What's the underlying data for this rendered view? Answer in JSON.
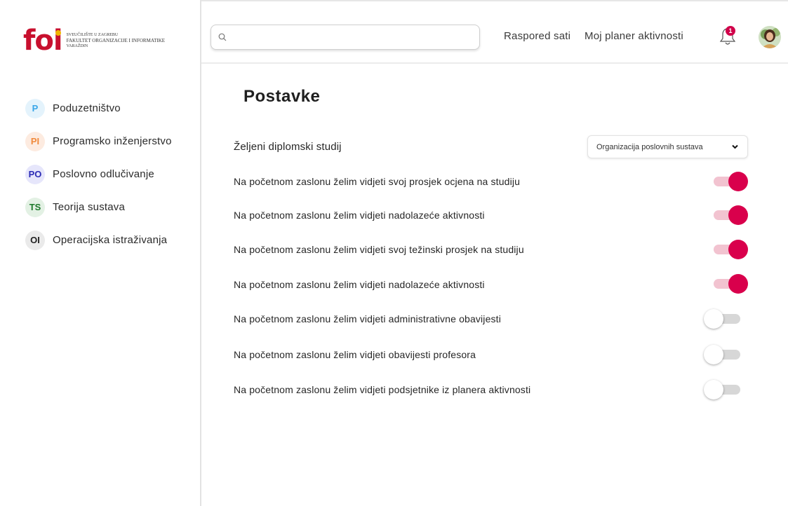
{
  "logo": {
    "mark": "foi",
    "line1": "Sveučilište u Zagrebu",
    "line2": "Fakultet organizacije i informatike",
    "line3": "Varaždin"
  },
  "sidebar": {
    "items": [
      {
        "abbr": "P",
        "label": "Poduzetništvo",
        "bg": "#e4f3fc",
        "fg": "#3aa6e8"
      },
      {
        "abbr": "PI",
        "label": "Programsko inženjerstvo",
        "bg": "#fdebe0",
        "fg": "#f08a3c"
      },
      {
        "abbr": "PO",
        "label": "Poslovno odlučivanje",
        "bg": "#e6e6fb",
        "fg": "#2b2bb5"
      },
      {
        "abbr": "TS",
        "label": "Teorija sustava",
        "bg": "#e3f1e4",
        "fg": "#1e7a2c"
      },
      {
        "abbr": "OI",
        "label": "Operacijska istraživanja",
        "bg": "#eaeaea",
        "fg": "#222222"
      }
    ]
  },
  "header": {
    "search_placeholder": "",
    "nav": [
      "Raspored sati",
      "Moj planer aktivnosti"
    ],
    "notification_count": "1"
  },
  "settings": {
    "title": "Postavke",
    "study_label": "Željeni diplomski studij",
    "study_selected": "Organizacija poslovnih sustava",
    "toggles": [
      {
        "label": "Na početnom zaslonu želim vidjeti svoj prosjek ocjena na studiju",
        "on": true
      },
      {
        "label": "Na početnom zaslonu želim vidjeti nadolazeće aktivnosti",
        "on": true
      },
      {
        "label": "Na početnom zaslonu želim vidjeti svoj težinski prosjek na studiju",
        "on": true
      },
      {
        "label": "Na početnom zaslonu želim vidjeti nadolazeće aktivnosti",
        "on": true
      },
      {
        "label": "Na početnom zaslonu želim vidjeti administrativne obavijesti",
        "on": false
      },
      {
        "label": "Na početnom zaslonu želim vidjeti obavijesti profesora",
        "on": false
      },
      {
        "label": "Na početnom zaslonu želim vidjeti podsjetnike iz planera aktivnosti",
        "on": false
      }
    ]
  },
  "colors": {
    "accent": "#d9004c",
    "accent_track": "#f2c3d0",
    "off_track": "#d7d7d7"
  }
}
